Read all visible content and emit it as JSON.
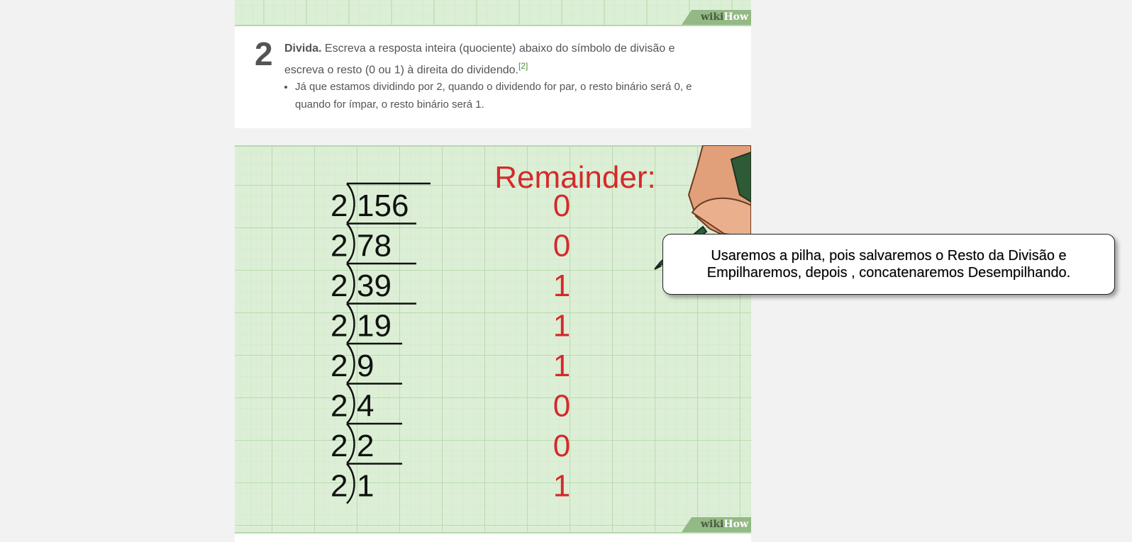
{
  "watermark": {
    "wiki": "wiki",
    "how": "How"
  },
  "step": {
    "number": "2",
    "title": "Divida.",
    "text": " Escreva a resposta inteira (quociente) abaixo do símbolo de divisão e escreva o resto (0 ou 1) à direita do dividendo.",
    "ref": "[2]",
    "bullet": "Já que estamos dividindo por 2, quando o dividendo for par, o resto binário será 0, e quando for ímpar, o resto binário será 1."
  },
  "illustration": {
    "remainder_label": "Remainder:",
    "divisor": "2",
    "rows": [
      {
        "dividend": "156",
        "remainder": "0"
      },
      {
        "dividend": "78",
        "remainder": "0"
      },
      {
        "dividend": "39",
        "remainder": "1"
      },
      {
        "dividend": "19",
        "remainder": "1"
      },
      {
        "dividend": "9",
        "remainder": "1"
      },
      {
        "dividend": "4",
        "remainder": "0"
      },
      {
        "dividend": "2",
        "remainder": "0"
      },
      {
        "dividend": "1",
        "remainder": "1"
      }
    ],
    "colors": {
      "paper": "#dcefd6",
      "grid": "#c2e0b8",
      "remainder": "#d42a2a",
      "ink": "#111111"
    }
  },
  "callout": {
    "text": "Usaremos a pilha, pois salvaremos o Resto da Divisão e Empilharemos, depois , concatenaremos Desempilhando."
  }
}
